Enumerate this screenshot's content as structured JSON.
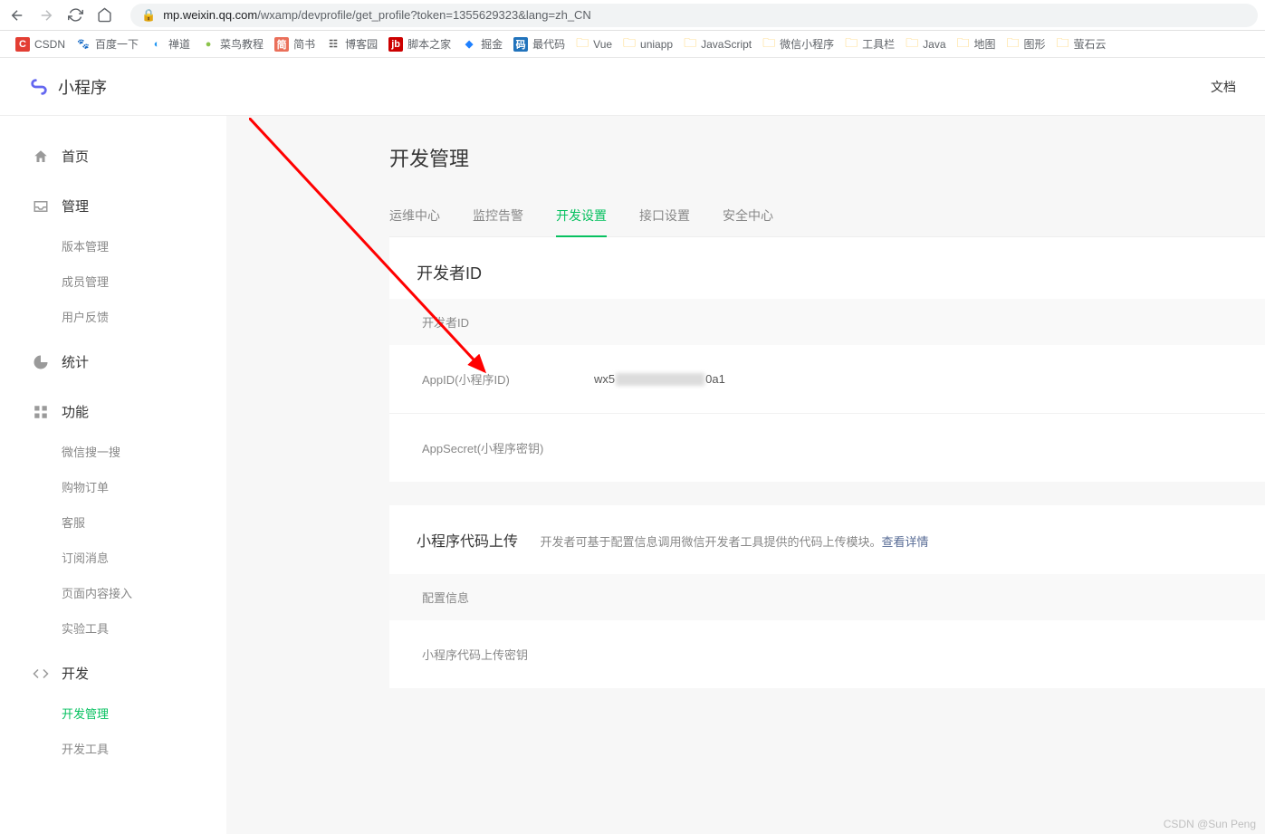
{
  "browser": {
    "url_host": "mp.weixin.qq.com",
    "url_path": "/wxamp/devprofile/get_profile?token=1355629323&lang=zh_CN"
  },
  "bookmarks": [
    {
      "label": "CSDN",
      "icon": "C",
      "bg": "#e33e33",
      "fg": "#fff"
    },
    {
      "label": "百度一下",
      "icon": "🐾",
      "bg": "",
      "fg": "#2932e1"
    },
    {
      "label": "禅道",
      "icon": "◐",
      "bg": "",
      "fg": "#2196f3"
    },
    {
      "label": "菜鸟教程",
      "icon": "●",
      "bg": "",
      "fg": "#8bc34a"
    },
    {
      "label": "简书",
      "icon": "简",
      "bg": "#ea6f5a",
      "fg": "#fff"
    },
    {
      "label": "博客园",
      "icon": "☷",
      "bg": "",
      "fg": "#555"
    },
    {
      "label": "脚本之家",
      "icon": "jb",
      "bg": "#c00",
      "fg": "#fff"
    },
    {
      "label": "掘金",
      "icon": "◆",
      "bg": "",
      "fg": "#1e80ff"
    },
    {
      "label": "最代码",
      "icon": "码",
      "bg": "#2173bc",
      "fg": "#fff"
    },
    {
      "label": "Vue",
      "icon": "folder"
    },
    {
      "label": "uniapp",
      "icon": "folder"
    },
    {
      "label": "JavaScript",
      "icon": "folder"
    },
    {
      "label": "微信小程序",
      "icon": "folder"
    },
    {
      "label": "工具栏",
      "icon": "folder"
    },
    {
      "label": "Java",
      "icon": "folder"
    },
    {
      "label": "地图",
      "icon": "folder"
    },
    {
      "label": "图形",
      "icon": "folder"
    },
    {
      "label": "萤石云",
      "icon": "folder"
    }
  ],
  "header": {
    "logo_text": "小程序",
    "docs_link": "文档"
  },
  "sidebar": [
    {
      "label": "首页",
      "type": "category",
      "icon": "home"
    },
    {
      "label": "管理",
      "type": "category",
      "icon": "inbox",
      "items": [
        "版本管理",
        "成员管理",
        "用户反馈"
      ]
    },
    {
      "label": "统计",
      "type": "category",
      "icon": "pie"
    },
    {
      "label": "功能",
      "type": "category",
      "icon": "grid",
      "items": [
        "微信搜一搜",
        "购物订单",
        "客服",
        "订阅消息",
        "页面内容接入",
        "实验工具"
      ]
    },
    {
      "label": "开发",
      "type": "category",
      "icon": "code",
      "items": [
        {
          "label": "开发管理",
          "active": true
        },
        {
          "label": "开发工具"
        }
      ]
    }
  ],
  "main": {
    "title": "开发管理",
    "tabs": [
      "运维中心",
      "监控告警",
      "开发设置",
      "接口设置",
      "安全中心"
    ],
    "active_tab": 2,
    "dev_id_section": {
      "title": "开发者ID",
      "sub_header": "开发者ID",
      "rows": [
        {
          "label": "AppID(小程序ID)",
          "value_prefix": "wx5",
          "value_redacted": true,
          "value_suffix": "0a1"
        },
        {
          "label": "AppSecret(小程序密钥)",
          "value_prefix": "",
          "value_redacted": false,
          "value_suffix": ""
        }
      ]
    },
    "upload_section": {
      "title": "小程序代码上传",
      "desc": "开发者可基于配置信息调用微信开发者工具提供的代码上传模块。",
      "link": "查看详情",
      "sub_header": "配置信息",
      "row_label": "小程序代码上传密钥"
    }
  },
  "watermark": "CSDN @Sun Peng"
}
